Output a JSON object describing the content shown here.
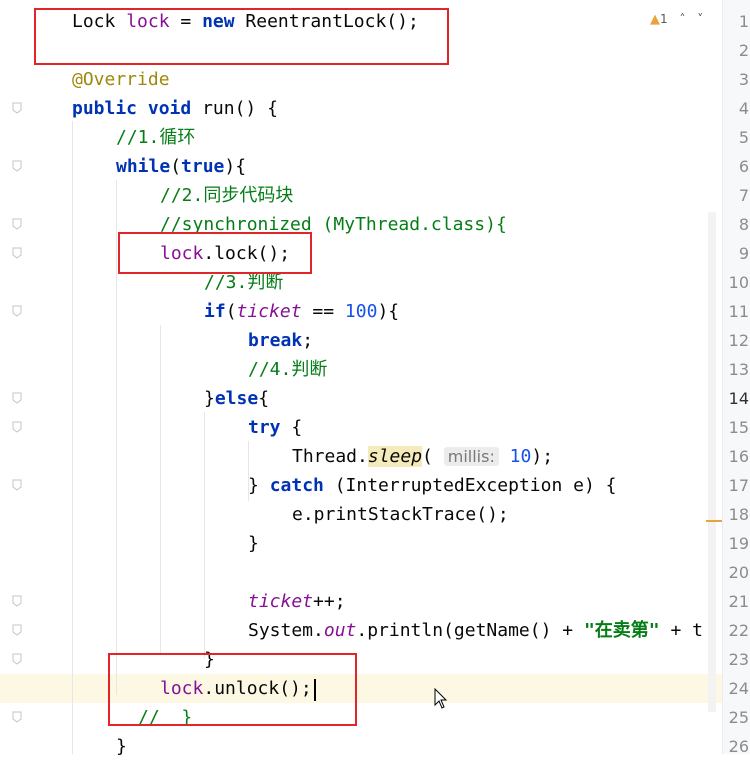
{
  "inspection": {
    "warning_count": "1",
    "up_arrow": "^",
    "down_arrow": "v"
  },
  "lines": [
    {
      "n": "1",
      "parts": [
        [
          "t",
          "Lock "
        ],
        [
          "var",
          "lock"
        ],
        [
          "t",
          " = "
        ],
        [
          "kw",
          "new"
        ],
        [
          "t",
          " ReentrantLock();"
        ]
      ]
    },
    {
      "n": "2",
      "parts": []
    },
    {
      "n": "3",
      "parts": [
        [
          "ann",
          "@Override"
        ]
      ]
    },
    {
      "n": "4",
      "parts": [
        [
          "kw",
          "public"
        ],
        [
          "t",
          " "
        ],
        [
          "kw",
          "void"
        ],
        [
          "t",
          " run() {"
        ]
      ]
    },
    {
      "n": "5",
      "parts": [
        [
          "cmt-g",
          "//1.循环"
        ]
      ]
    },
    {
      "n": "6",
      "parts": [
        [
          "kw",
          "while"
        ],
        [
          "t",
          "("
        ],
        [
          "kw",
          "true"
        ],
        [
          "t",
          ")"
        ],
        [
          "t",
          "{"
        ]
      ]
    },
    {
      "n": "7",
      "parts": [
        [
          "cmt-g",
          "//2.同步代码块"
        ]
      ]
    },
    {
      "n": "8",
      "parts": [
        [
          "cmt-g",
          "//synchronized (MyThread.class){"
        ]
      ]
    },
    {
      "n": "9",
      "parts": [
        [
          "var",
          "lock"
        ],
        [
          "t",
          ".lock();"
        ]
      ]
    },
    {
      "n": "10",
      "parts": [
        [
          "cmt-g",
          "//3.判断"
        ]
      ]
    },
    {
      "n": "11",
      "parts": [
        [
          "kw",
          "if"
        ],
        [
          "t",
          "("
        ],
        [
          "field",
          "ticket"
        ],
        [
          "t",
          " == "
        ],
        [
          "num",
          "100"
        ],
        [
          "t",
          "){"
        ]
      ]
    },
    {
      "n": "12",
      "parts": [
        [
          "kw",
          "break"
        ],
        [
          "t",
          ";"
        ]
      ]
    },
    {
      "n": "13",
      "parts": [
        [
          "cmt-g",
          "//4.判断"
        ]
      ]
    },
    {
      "n": "14",
      "parts": [
        [
          "t",
          "}"
        ],
        [
          "kw",
          "else"
        ],
        [
          "t",
          "{"
        ]
      ]
    },
    {
      "n": "15",
      "parts": [
        [
          "kw",
          "try"
        ],
        [
          "t",
          " {"
        ]
      ]
    },
    {
      "n": "16",
      "parts": [
        [
          "t",
          "Thread."
        ],
        [
          "static",
          "sleep"
        ],
        [
          "t",
          "( "
        ],
        [
          "hint",
          "millis:"
        ],
        [
          "t",
          " "
        ],
        [
          "num",
          "10"
        ],
        [
          "t",
          ");"
        ]
      ]
    },
    {
      "n": "17",
      "parts": [
        [
          "t",
          "} "
        ],
        [
          "kw",
          "catch"
        ],
        [
          "t",
          " (InterruptedException e) {"
        ]
      ]
    },
    {
      "n": "18",
      "parts": [
        [
          "t",
          "e.printStackTrace();"
        ]
      ]
    },
    {
      "n": "19",
      "parts": [
        [
          "t",
          "}"
        ]
      ]
    },
    {
      "n": "20",
      "parts": []
    },
    {
      "n": "21",
      "parts": [
        [
          "field",
          "ticket"
        ],
        [
          "t",
          "++;"
        ]
      ]
    },
    {
      "n": "22",
      "parts": [
        [
          "t",
          "System."
        ],
        [
          "fieldi",
          "out"
        ],
        [
          "t",
          ".println(getName() + "
        ],
        [
          "str",
          "\"在卖第\""
        ],
        [
          "t",
          " + t"
        ]
      ]
    },
    {
      "n": "23",
      "parts": [
        [
          "t",
          "}"
        ]
      ]
    },
    {
      "n": "24",
      "parts": [
        [
          "var",
          "lock"
        ],
        [
          "t",
          ".unlock();"
        ]
      ]
    },
    {
      "n": "25",
      "parts": [
        [
          "cmt-g",
          "//  }"
        ]
      ]
    },
    {
      "n": "26",
      "parts": [
        [
          "t",
          "}"
        ]
      ]
    }
  ]
}
